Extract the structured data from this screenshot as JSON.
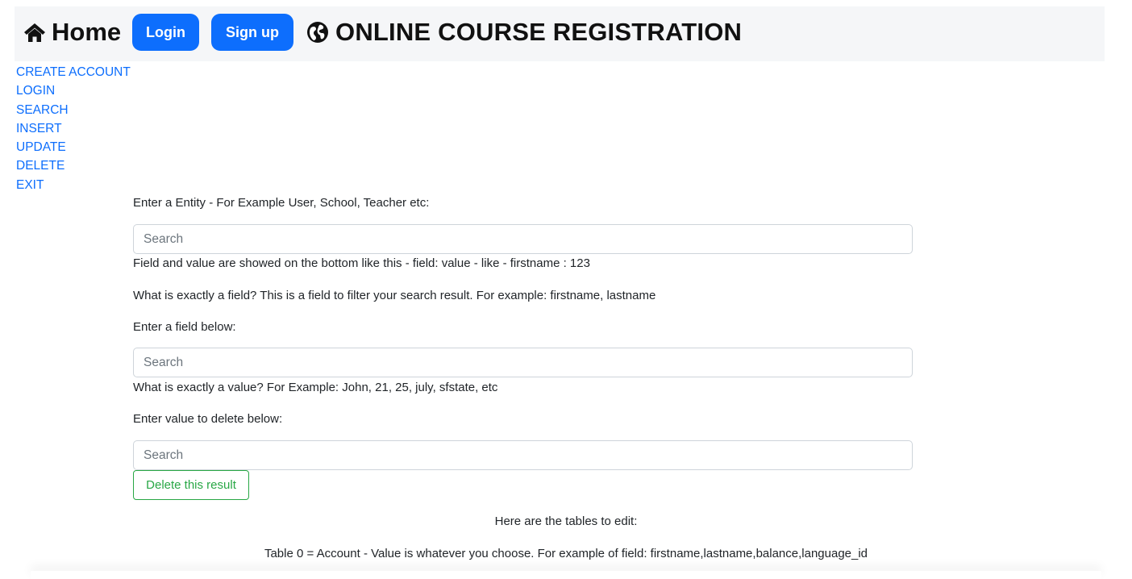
{
  "navbar": {
    "home_label": "Home",
    "home_icon": "home-icon",
    "login_label": "Login",
    "signup_label": "Sign up",
    "title_icon": "globe-icon",
    "title": "ONLINE COURSE REGISTRATION",
    "accent_color": "#0d6efd"
  },
  "sidebar": {
    "items": [
      {
        "label": "CREATE ACCOUNT"
      },
      {
        "label": "LOGIN"
      },
      {
        "label": "SEARCH"
      },
      {
        "label": "INSERT"
      },
      {
        "label": "UPDATE"
      },
      {
        "label": "DELETE"
      },
      {
        "label": "EXIT"
      }
    ]
  },
  "form": {
    "entity_prompt": "Enter a Entity - For Example User, School, Teacher etc:",
    "entity_placeholder": "Search",
    "field_value_hint": "Field and value are showed on the bottom like this - field: value - like - firstname : 123",
    "field_explain": "What is exactly a field? This is a field to filter your search result. For example: firstname, lastname",
    "field_prompt": "Enter a field below:",
    "field_placeholder": "Search",
    "value_explain": "What is exactly a value? For Example: John, 21, 25, july, sfstate, etc",
    "value_prompt": "Enter value to delete below:",
    "value_placeholder": "Search",
    "delete_button": "Delete this result",
    "delete_color": "#28a745"
  },
  "tables": {
    "heading": "Here are the tables to edit:",
    "table0": "Table 0 = Account - Value is whatever you choose. For example of field: firstname,lastname,balance,language_id"
  }
}
